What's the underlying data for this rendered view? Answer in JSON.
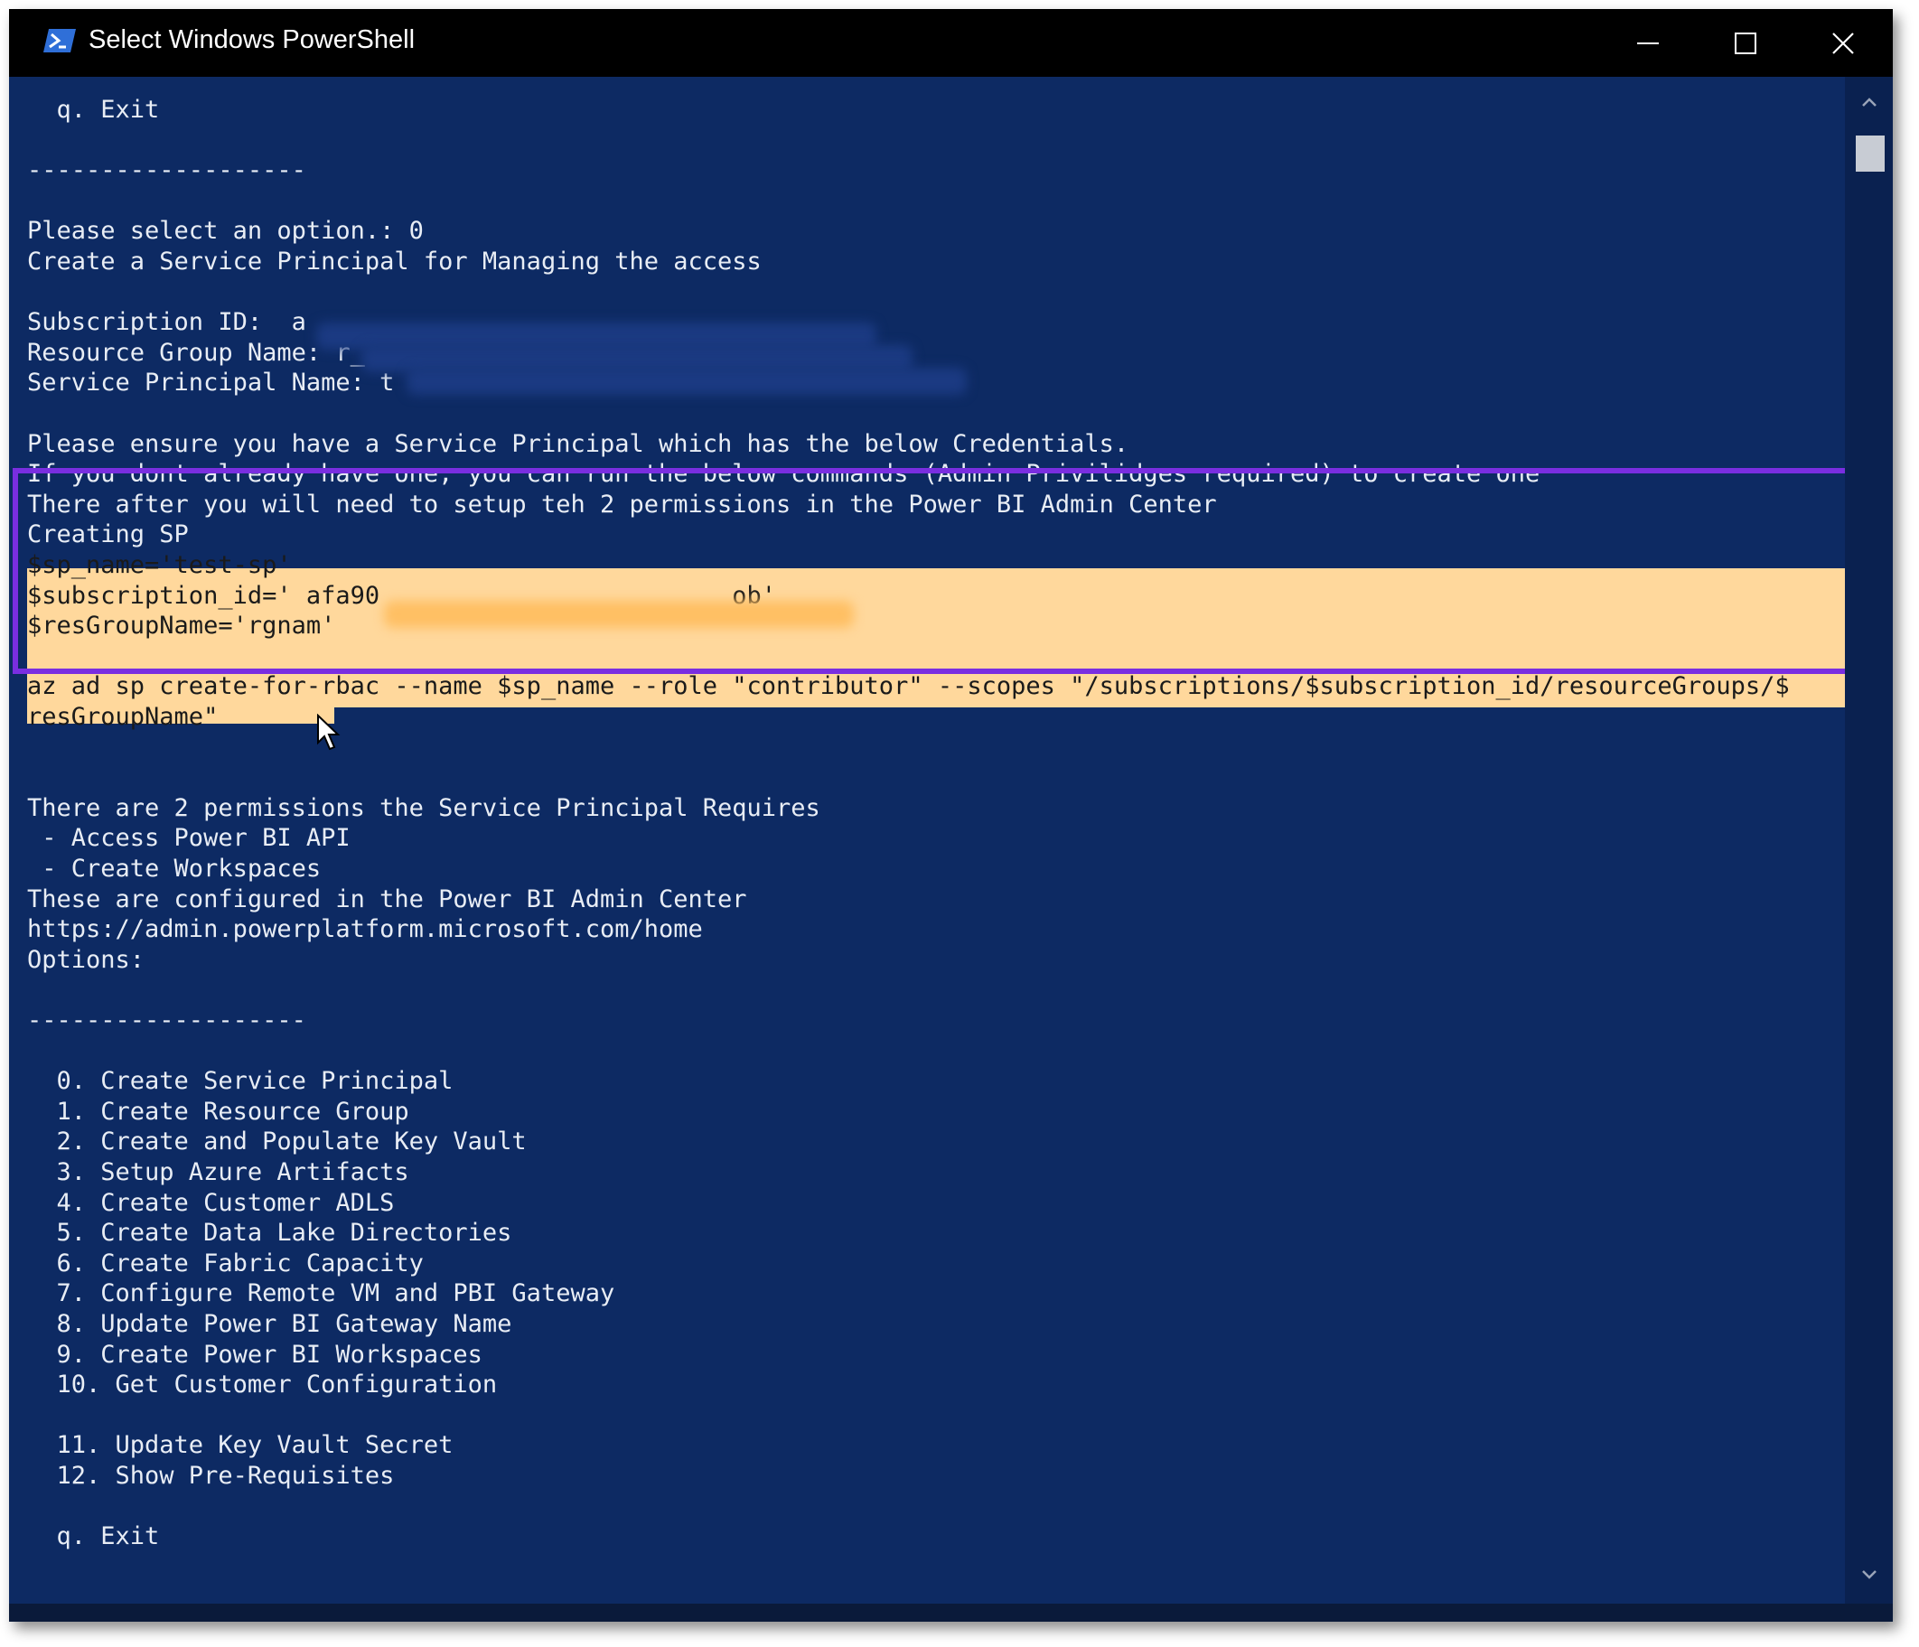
{
  "window": {
    "title": "Select Windows PowerShell",
    "controls": {
      "minimize": "minimize-icon",
      "maximize": "maximize-icon",
      "close": "close-icon"
    },
    "icon": "powershell-icon"
  },
  "terminal": {
    "before_selection": [
      "  q. Exit",
      "",
      "-------------------",
      "",
      "Please select an option.: 0",
      "Create a Service Principal for Managing the access",
      "",
      "Subscription ID:  a",
      "Resource Group Name: r_",
      "Service Principal Name: t",
      "",
      "Please ensure you have a Service Principal which has the below Credentials.",
      "If you dont already have one, you can run the below commands (Admin Privilidges required) to create one",
      "There after you will need to setup teh 2 permissions in the Power BI Admin Center"
    ],
    "selection": [
      "Creating SP",
      "$sp_name='test-sp'",
      "$subscription_id=' afa90                        ob'",
      "$resGroupName='rgnam'",
      "",
      "az ad sp create-for-rbac --name $sp_name --role \"contributor\" --scopes \"/subscriptions/$subscription_id/resourceGroups/$",
      "resGroupName\""
    ],
    "after_selection": [
      "",
      "",
      "There are 2 permissions the Service Principal Requires",
      " - Access Power BI API",
      " - Create Workspaces",
      "These are configured in the Power BI Admin Center",
      "https://admin.powerplatform.microsoft.com/home",
      "Options:",
      "",
      "-------------------",
      "",
      "  0. Create Service Principal",
      "  1. Create Resource Group",
      "  2. Create and Populate Key Vault",
      "  3. Setup Azure Artifacts",
      "  4. Create Customer ADLS",
      "  5. Create Data Lake Directories",
      "  6. Create Fabric Capacity",
      "  7. Configure Remote VM and PBI Gateway",
      "  8. Update Power BI Gateway Name",
      "  9. Create Power BI Workspaces",
      "  10. Get Customer Configuration",
      "",
      "  11. Update Key Vault Secret",
      "  12. Show Pre-Requisites",
      "",
      "  q. Exit"
    ]
  },
  "colors": {
    "terminal_bg": "#0d2a63",
    "terminal_fg": "#e8edf5",
    "selection_bg": "#ffd89c",
    "highlight_border": "#7a2ee0"
  }
}
